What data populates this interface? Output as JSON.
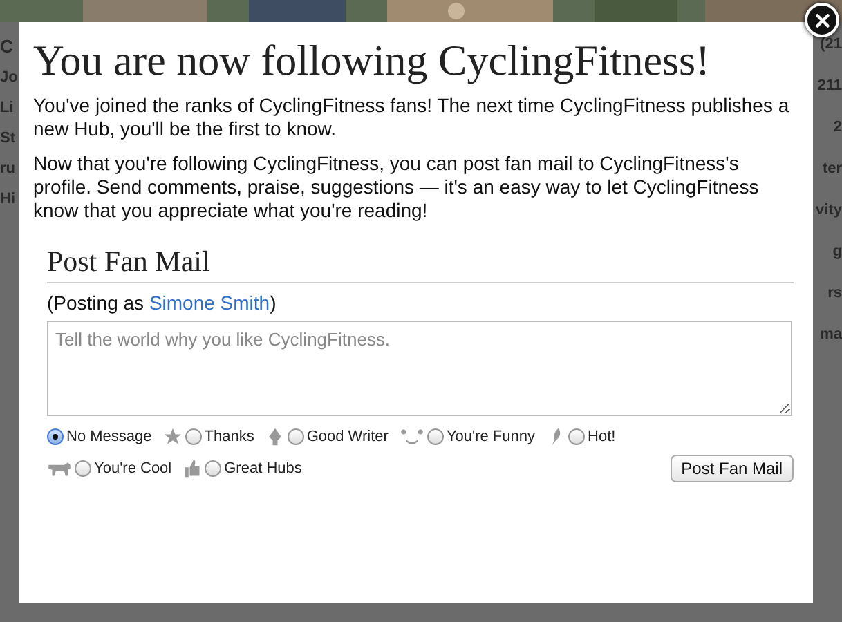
{
  "background": {
    "left_fragments": [
      "C",
      "Jo",
      "Li",
      "St",
      "ru",
      "Hi"
    ],
    "right_fragments": [
      "(21",
      "211",
      "2",
      "ter",
      "vity",
      "g",
      "rs",
      "ma"
    ]
  },
  "dialog": {
    "title": "You are now following CyclingFitness!",
    "paragraphs": [
      "You've joined the ranks of CyclingFitness fans! The next time CyclingFitness publishes a new Hub, you'll be the first to know.",
      "Now that you're following CyclingFitness, you can post fan mail to CyclingFitness's profile. Send comments, praise, suggestions — it's an easy way to let CyclingFitness know that you appreciate what you're reading!"
    ],
    "section_title": "Post Fan Mail",
    "posting_as": {
      "prefix": "(Posting as ",
      "name": "Simone Smith",
      "suffix": ")"
    },
    "message": {
      "placeholder": "Tell the world why you like CyclingFitness."
    },
    "option_rows": [
      [
        {
          "kind": "plain",
          "label": "No Message",
          "selected": true
        },
        {
          "kind": "star",
          "label": "Thanks",
          "selected": false
        },
        {
          "kind": "pen",
          "label": "Good Writer",
          "selected": false
        },
        {
          "kind": "face",
          "label": "You're Funny",
          "selected": false
        },
        {
          "kind": "flame",
          "label": "Hot!",
          "selected": false
        }
      ],
      [
        {
          "kind": "bear",
          "label": "You're Cool",
          "selected": false
        },
        {
          "kind": "thumb",
          "label": "Great Hubs",
          "selected": false
        }
      ]
    ],
    "submit_button": "Post Fan Mail"
  }
}
